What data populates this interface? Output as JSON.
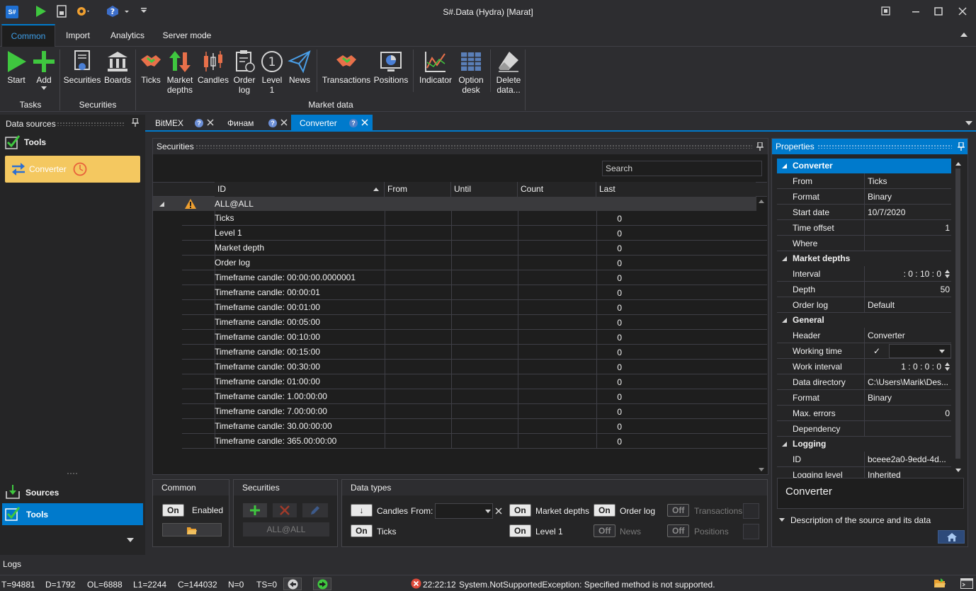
{
  "window": {
    "title": "S#.Data (Hydra) [Marat]",
    "app_icon": "S#"
  },
  "ribbon_tabs": [
    "Common",
    "Import",
    "Analytics",
    "Server mode"
  ],
  "ribbon": {
    "buttons": {
      "start": "Start",
      "add": "Add",
      "securities": "Securities",
      "boards": "Boards",
      "ticks": "Ticks",
      "market_depths_1": "Market",
      "market_depths_2": "depths",
      "candles": "Candles",
      "order_log_1": "Order",
      "order_log_2": "log",
      "level1_1": "Level",
      "level1_2": "1",
      "news": "News",
      "transactions": "Transactions",
      "positions": "Positions",
      "indicator": "Indicator",
      "option_desk_1": "Option",
      "option_desk_2": "desk",
      "delete_data_1": "Delete",
      "delete_data_2": "data..."
    },
    "groups": {
      "tasks": "Tasks",
      "securities": "Securities",
      "market_data": "Market data"
    }
  },
  "left_panel": {
    "header": "Data sources",
    "tools_label": "Tools",
    "converter_label": "Converter",
    "sources_label": "Sources",
    "tools_nav_label": "Tools"
  },
  "doc_tabs": [
    {
      "label": "BitMEX"
    },
    {
      "label": "Финам"
    },
    {
      "label": "Converter"
    }
  ],
  "securities_panel": {
    "header": "Securities",
    "search_placeholder": "Search",
    "columns": [
      "ID",
      "From",
      "Until",
      "Count",
      "Last"
    ],
    "group_row": "ALL@ALL",
    "rows": [
      {
        "id": "Ticks",
        "count": "0"
      },
      {
        "id": "Level 1",
        "count": "0"
      },
      {
        "id": "Market depth",
        "count": "0"
      },
      {
        "id": "Order log",
        "count": "0"
      },
      {
        "id": "Timeframe candle: 00:00:00.0000001",
        "count": "0"
      },
      {
        "id": "Timeframe candle: 00:00:01",
        "count": "0"
      },
      {
        "id": "Timeframe candle: 00:01:00",
        "count": "0"
      },
      {
        "id": "Timeframe candle: 00:05:00",
        "count": "0"
      },
      {
        "id": "Timeframe candle: 00:10:00",
        "count": "0"
      },
      {
        "id": "Timeframe candle: 00:15:00",
        "count": "0"
      },
      {
        "id": "Timeframe candle: 00:30:00",
        "count": "0"
      },
      {
        "id": "Timeframe candle: 01:00:00",
        "count": "0"
      },
      {
        "id": "Timeframe candle: 1.00:00:00",
        "count": "0"
      },
      {
        "id": "Timeframe candle: 7.00:00:00",
        "count": "0"
      },
      {
        "id": "Timeframe candle: 30.00:00:00",
        "count": "0"
      },
      {
        "id": "Timeframe candle: 365.00:00:00",
        "count": "0"
      }
    ]
  },
  "bottom": {
    "common": {
      "title": "Common",
      "on": "On",
      "enabled": "Enabled"
    },
    "securities": {
      "title": "Securities",
      "all": "ALL@ALL"
    },
    "data_types": {
      "title": "Data types",
      "candles": "Candles",
      "from": "From:",
      "ticks": "Ticks",
      "on": "On",
      "off": "Off",
      "market_depths": "Market depths",
      "order_log": "Order log",
      "transactions": "Transactions",
      "level1": "Level 1",
      "news": "News",
      "positions": "Positions",
      "arrow": "↓"
    }
  },
  "properties": {
    "header": "Properties",
    "cat_converter": "Converter",
    "cat_market_depths": "Market depths",
    "cat_general": "General",
    "cat_logging": "Logging",
    "rows": {
      "from": {
        "name": "From",
        "value": "Ticks"
      },
      "format": {
        "name": "Format",
        "value": "Binary"
      },
      "start_date": {
        "name": "Start date",
        "value": "10/7/2020"
      },
      "time_offset": {
        "name": "Time offset",
        "value": "1"
      },
      "where": {
        "name": "Where",
        "value": ""
      },
      "interval": {
        "name": "Interval",
        "value": ": 0 : 10 : 0"
      },
      "depth": {
        "name": "Depth",
        "value": "50"
      },
      "order_log": {
        "name": "Order log",
        "value": "Default"
      },
      "header": {
        "name": "Header",
        "value": "Converter"
      },
      "working_time": {
        "name": "Working time",
        "value": "✓"
      },
      "work_interval": {
        "name": "Work interval",
        "value": "1 : 0 : 0 : 0"
      },
      "data_directory": {
        "name": "Data directory",
        "value": "C:\\Users\\Marik\\Des..."
      },
      "format2": {
        "name": "Format",
        "value": "Binary"
      },
      "max_errors": {
        "name": "Max. errors",
        "value": "0"
      },
      "dependency": {
        "name": "Dependency",
        "value": ""
      },
      "id": {
        "name": "ID",
        "value": "bceee2a0-9edd-4d..."
      },
      "logging_level": {
        "name": "Logging level",
        "value": "Inherited"
      }
    },
    "selected_name": "Converter",
    "description_label": "Description of the source and its data"
  },
  "logs_label": "Logs",
  "status": {
    "t": "T=94881",
    "d": "D=1792",
    "ol": "OL=6888",
    "l1": "L1=2244",
    "c": "C=144032",
    "n": "N=0",
    "ts": "TS=0",
    "time": "22:22:12",
    "message": "System.NotSupportedException: Specified method is not supported."
  }
}
